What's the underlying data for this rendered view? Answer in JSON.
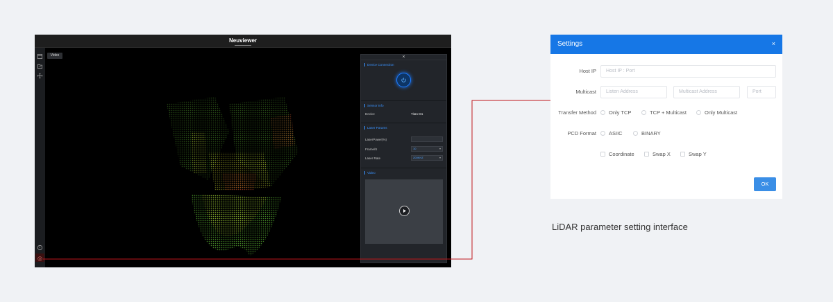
{
  "app": {
    "title": "Neuviewer",
    "video_tag": "Video",
    "panel": {
      "close": "×",
      "device_connection": "Device Connection",
      "sensor_info": "Sensor Info",
      "device_label": "Device",
      "device_value": "Titan M1",
      "laser_params": "Laser Params",
      "laser_power_label": "LaserPower(%)",
      "frame_label": "Frame/S",
      "frame_value": "10",
      "laser_rate_label": "Laser Rate",
      "laser_rate_value": "200KHZ",
      "video_section": "Video"
    },
    "left_icons": [
      "file-icon",
      "folder-icon",
      "move-icon",
      "info-icon",
      "settings-icon"
    ]
  },
  "settings": {
    "title": "Settings",
    "close": "×",
    "host_ip_label": "Host IP",
    "host_ip_placeholder": "Host IP : Port",
    "multicast_label": "Multicast",
    "listen_placeholder": "Listen Address",
    "multicast_placeholder": "Multicast Address",
    "port_placeholder": "Port",
    "transfer_label": "Transfer Method",
    "transfer_options": [
      "Only TCP",
      "TCP + Multicast",
      "Only Multicast"
    ],
    "pcd_label": "PCD Format",
    "pcd_options": [
      "ASIIC",
      "BINARY"
    ],
    "check_options": [
      "Coordinate",
      "Swap X",
      "Swap Y"
    ],
    "ok": "OK"
  },
  "caption": "LiDAR parameter setting interface",
  "colors": {
    "accent": "#1677e6",
    "connector": "#c0161b",
    "panel_blue": "#3a93ff"
  }
}
